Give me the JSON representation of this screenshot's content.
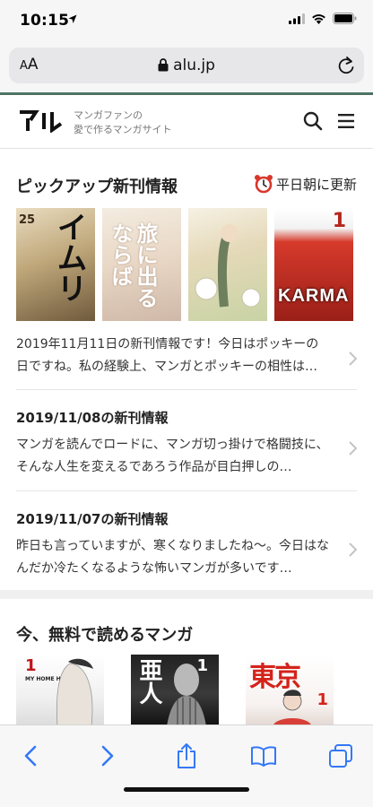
{
  "status": {
    "time": "10:15"
  },
  "browser": {
    "aa_label": "AA",
    "url": "alu.jp"
  },
  "site": {
    "logo_text": "アル",
    "tagline_line1": "マンガファンの",
    "tagline_line2": "愛で作るマンガサイト"
  },
  "pickup": {
    "title": "ピックアップ新刊情報",
    "update_label": "平日朝に更新",
    "covers": [
      {
        "text": "イムリ",
        "volume": "25"
      },
      {
        "text": "旅に出るならば"
      },
      {
        "text": ""
      },
      {
        "text": "KARMA",
        "volume": "1"
      }
    ],
    "items": [
      {
        "title": "",
        "body": "2019年11月11日の新刊情報です！今日はポッキーの日ですね。私の経験上、マンガとポッキーの相性は…"
      },
      {
        "title": "2019/11/08の新刊情報",
        "body": "マンガを読んでロードに、マンガ切っ掛けで格闘技に、そんな人生を変えるであろう作品が目白押しの…"
      },
      {
        "title": "2019/11/07の新刊情報",
        "body": "昨日も言っていますが、寒くなりましたね〜。今日はなんだか冷たくなるような怖いマンガが多いです…"
      }
    ]
  },
  "free": {
    "title": "今、無料で読めるマンガ",
    "covers": [
      {
        "text": "MY HOME HERO",
        "volume": "1"
      },
      {
        "text": "亜人",
        "volume": "1"
      },
      {
        "text": "東京",
        "volume": "1"
      }
    ]
  },
  "colors": {
    "accent": "#4e7363",
    "clock_red": "#d9362b",
    "ios_blue": "#3478f6"
  }
}
